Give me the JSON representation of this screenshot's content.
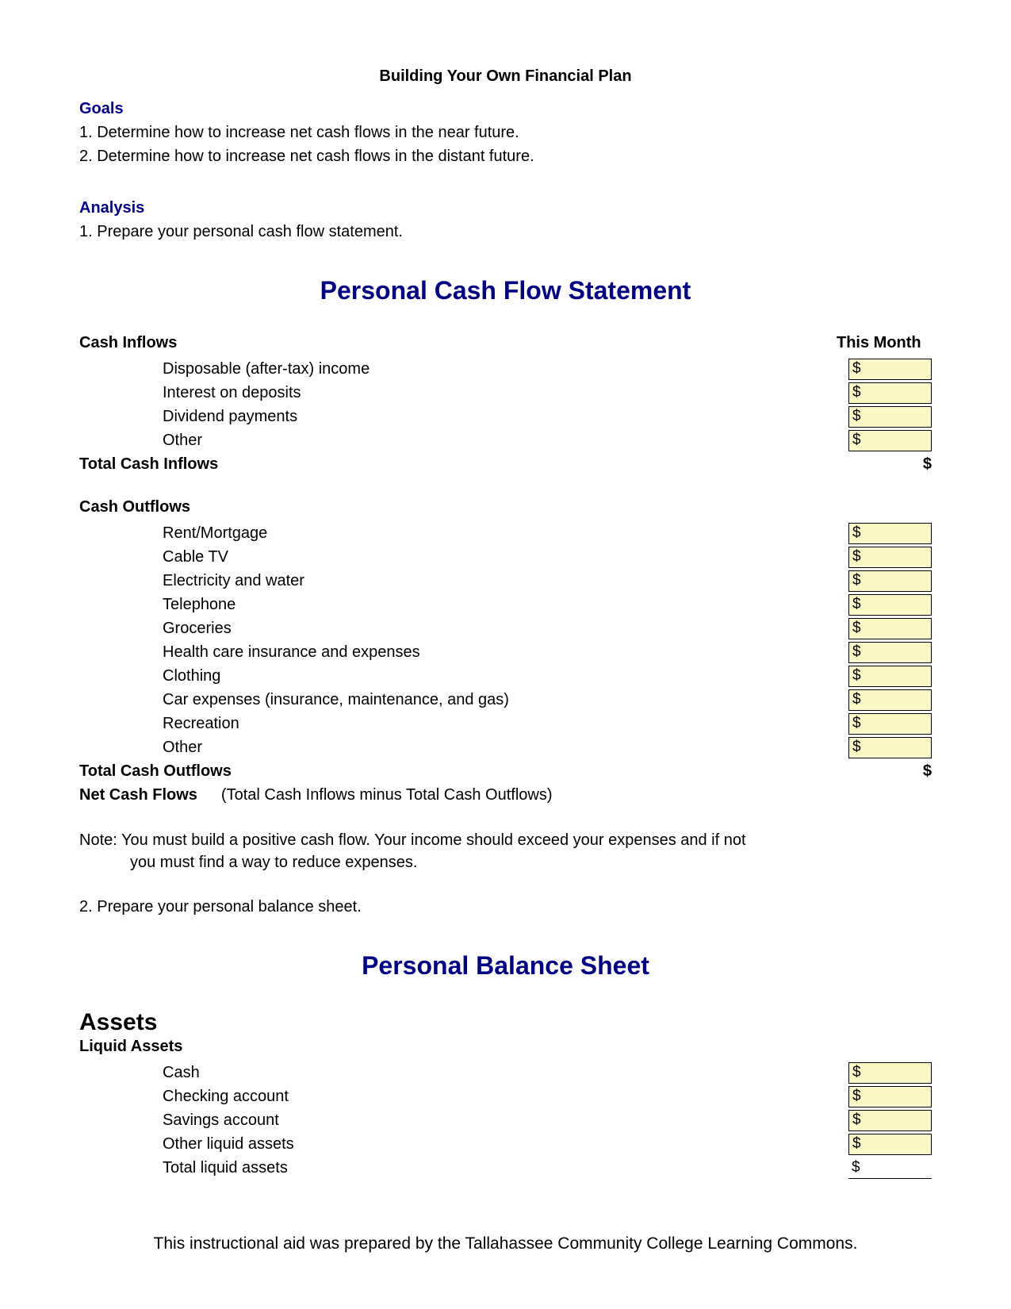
{
  "pageTitle": "Building Your Own Financial Plan",
  "goals": {
    "header": "Goals",
    "items": [
      "1. Determine how to increase net cash flows in the near future.",
      "2. Determine how to increase net cash flows in the distant future."
    ]
  },
  "analysis": {
    "header": "Analysis",
    "items": [
      "1. Prepare your personal cash flow statement."
    ]
  },
  "cashFlowTitle": "Personal Cash Flow Statement",
  "cashInflows": {
    "header": "Cash Inflows",
    "monthHeader": "This Month",
    "items": [
      "Disposable (after-tax) income",
      "Interest on deposits",
      "Dividend payments",
      "Other"
    ],
    "totalLabel": "Total Cash Inflows",
    "dollar": "$"
  },
  "cashOutflows": {
    "header": "Cash Outflows",
    "items": [
      "Rent/Mortgage",
      "Cable TV",
      "Electricity and water",
      "Telephone",
      "Groceries",
      "Health care insurance and expenses",
      "Clothing",
      "Car expenses (insurance, maintenance, and gas)",
      "Recreation",
      "Other"
    ],
    "totalLabel": "Total Cash Outflows",
    "dollar": "$"
  },
  "netCashFlows": {
    "label": "Net Cash Flows",
    "desc": "(Total Cash Inflows minus Total Cash Outflows)"
  },
  "note": {
    "line1": "Note: You must build a positive cash flow.  Your income should exceed your expenses and if not",
    "line2": "you must find a way to reduce expenses."
  },
  "step2": "2. Prepare your personal balance sheet.",
  "balanceSheetTitle": "Personal Balance Sheet",
  "assets": {
    "header": "Assets",
    "liquidHeader": "Liquid Assets",
    "items": [
      "Cash",
      "Checking account",
      "Savings account",
      "Other liquid assets"
    ],
    "totalLabel": "Total liquid assets",
    "dollar": "$"
  },
  "footer": "This instructional aid was prepared by the Tallahassee Community College Learning Commons."
}
